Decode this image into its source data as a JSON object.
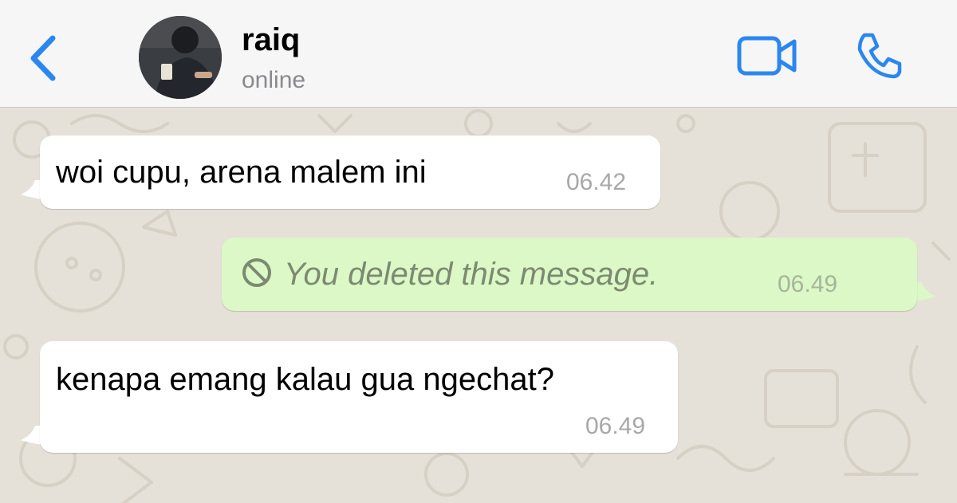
{
  "contact": {
    "name": "raiq",
    "status": "online"
  },
  "icons": {
    "back": "chevron-left-icon",
    "video": "video-camera-icon",
    "call": "phone-icon",
    "deleted": "prohibited-icon"
  },
  "colors": {
    "accent": "#2b87f0",
    "incoming_bubble": "#ffffff",
    "outgoing_bubble": "#dcf8c6",
    "wallpaper": "#e6e1d8"
  },
  "messages": [
    {
      "direction": "incoming",
      "text": "woi cupu, arena malem ini",
      "time": "06.42"
    },
    {
      "direction": "outgoing",
      "text": "You deleted this message.",
      "time": "06.49",
      "deleted": true
    },
    {
      "direction": "incoming",
      "text": "kenapa emang kalau gua ngechat?",
      "time": "06.49"
    }
  ]
}
